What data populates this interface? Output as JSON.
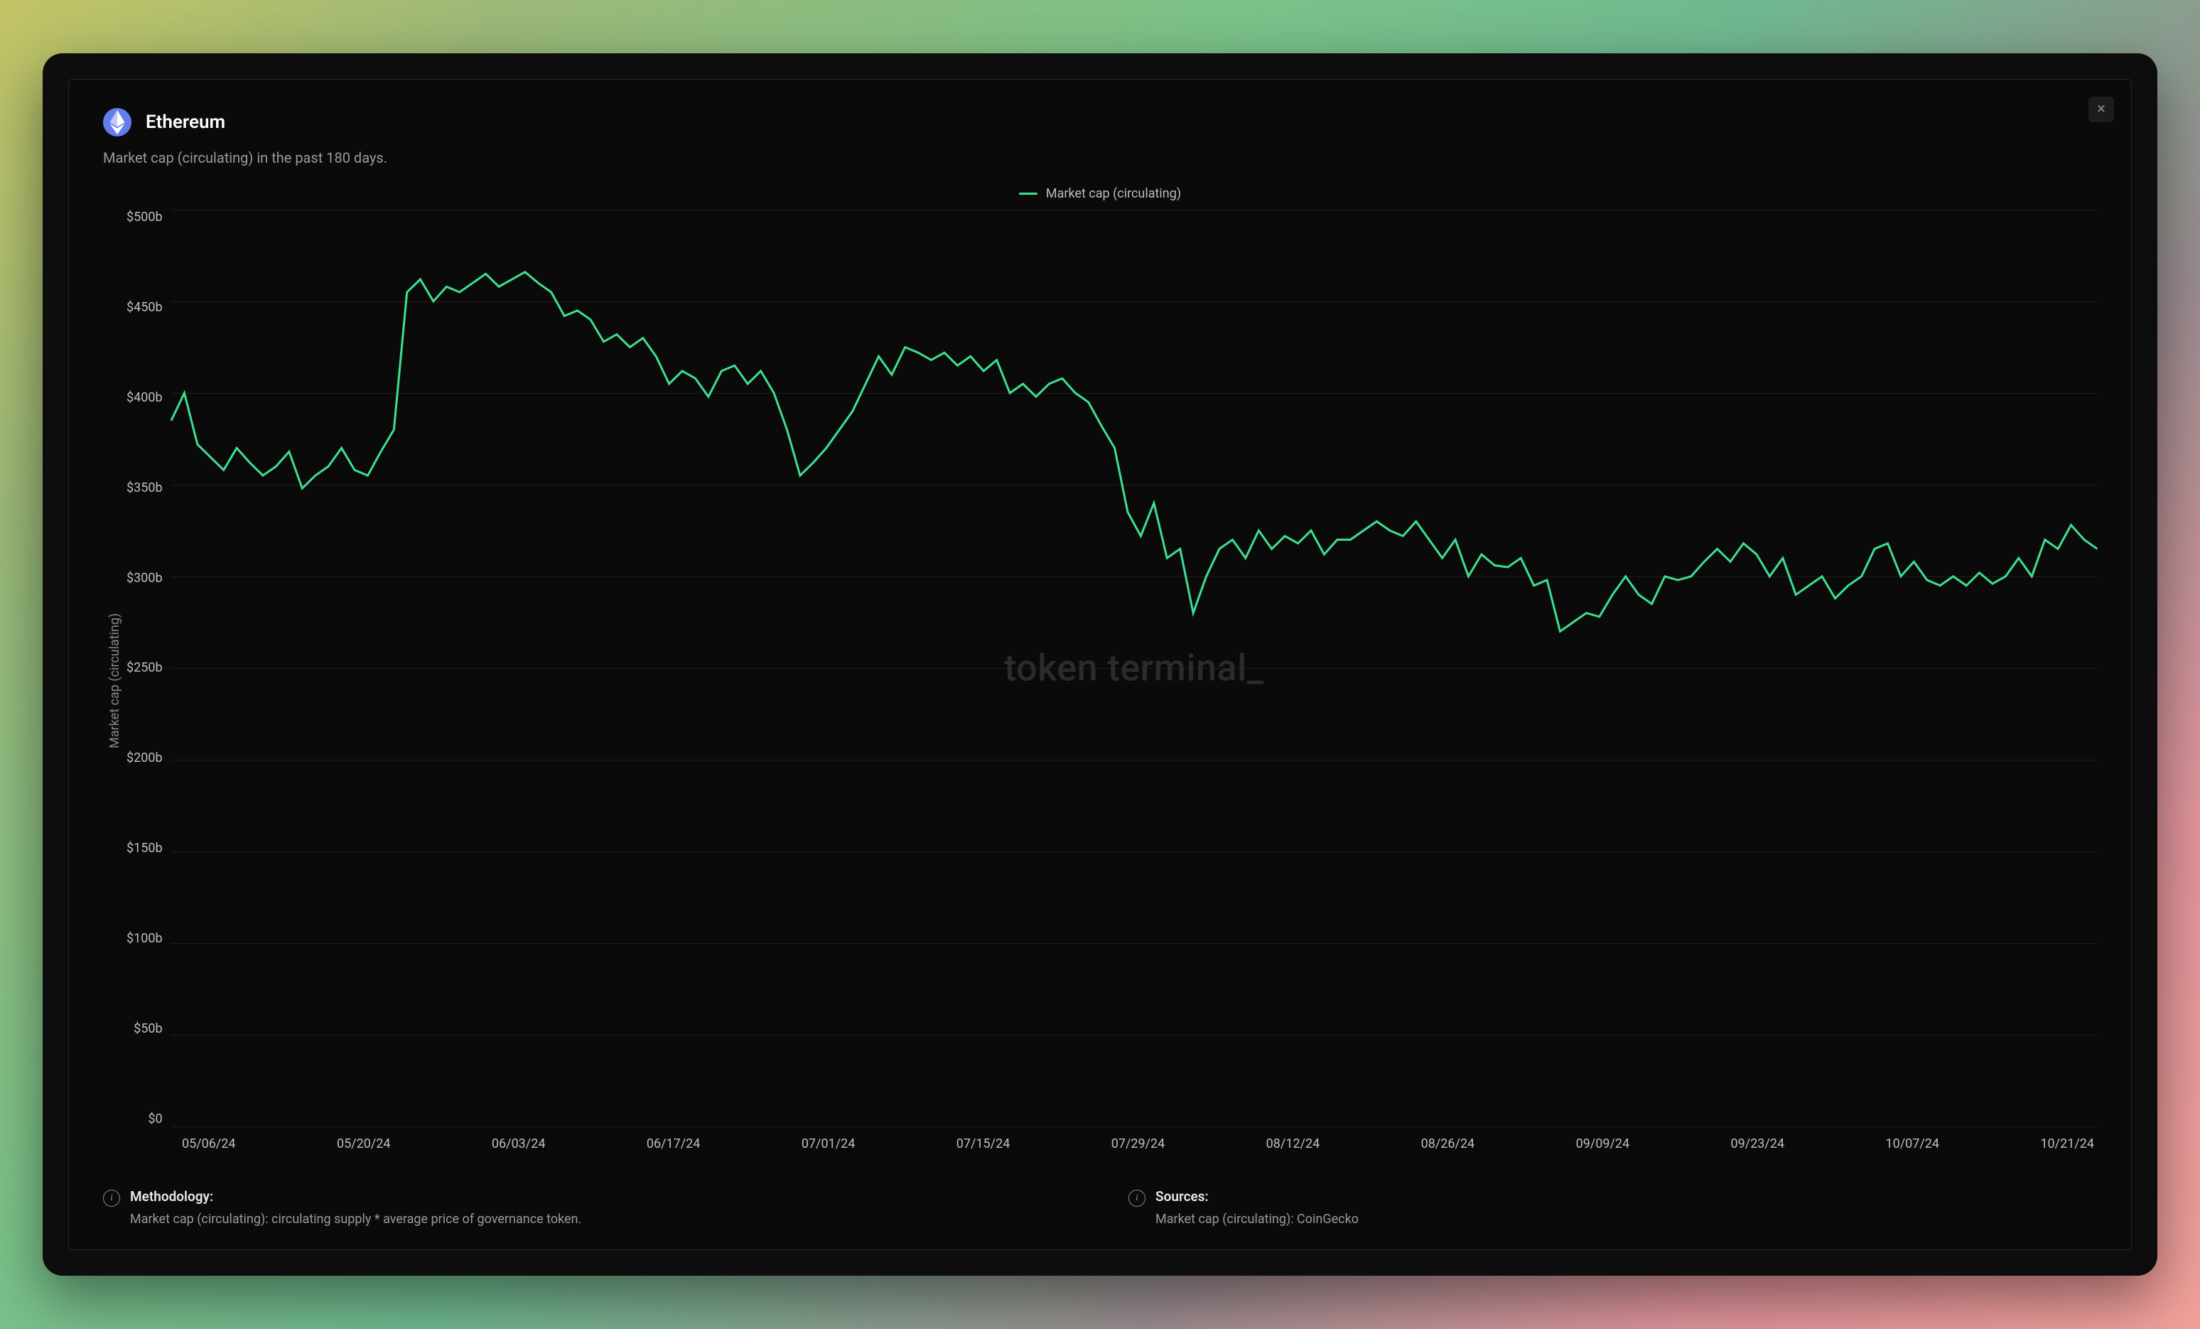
{
  "header": {
    "title": "Ethereum",
    "subtitle": "Market cap (circulating) in the past 180 days."
  },
  "legend": {
    "label": "Market cap (circulating)"
  },
  "watermark": "token terminal_",
  "footer": {
    "methodology": {
      "title": "Methodology:",
      "body": "Market cap (circulating): circulating supply * average price of governance token."
    },
    "sources": {
      "title": "Sources:",
      "body": "Market cap (circulating): CoinGecko"
    }
  },
  "chart_data": {
    "type": "line",
    "title": "Ethereum Market cap (circulating) in the past 180 days.",
    "xlabel": "",
    "ylabel": "Market cap (circulating)",
    "ylim": [
      0,
      500
    ],
    "y_unit": "b USD",
    "y_ticks": [
      "$500b",
      "$450b",
      "$400b",
      "$350b",
      "$300b",
      "$250b",
      "$200b",
      "$150b",
      "$100b",
      "$50b",
      "$0"
    ],
    "x_ticks": [
      "05/06/24",
      "05/20/24",
      "06/03/24",
      "06/17/24",
      "07/01/24",
      "07/15/24",
      "07/29/24",
      "08/12/24",
      "08/26/24",
      "09/09/24",
      "09/23/24",
      "10/07/24",
      "10/21/24"
    ],
    "series": [
      {
        "name": "Market cap (circulating)",
        "color": "#3de08f",
        "values": [
          385,
          400,
          372,
          365,
          358,
          370,
          362,
          355,
          360,
          368,
          348,
          355,
          360,
          370,
          358,
          355,
          368,
          380,
          455,
          462,
          450,
          458,
          455,
          460,
          465,
          458,
          462,
          466,
          460,
          455,
          442,
          445,
          440,
          428,
          432,
          425,
          430,
          420,
          405,
          412,
          408,
          398,
          412,
          415,
          405,
          412,
          400,
          380,
          355,
          362,
          370,
          380,
          390,
          405,
          420,
          410,
          425,
          422,
          418,
          422,
          415,
          420,
          412,
          418,
          400,
          405,
          398,
          405,
          408,
          400,
          395,
          382,
          370,
          335,
          322,
          340,
          310,
          315,
          280,
          300,
          315,
          320,
          310,
          325,
          315,
          322,
          318,
          325,
          312,
          320,
          320,
          325,
          330,
          325,
          322,
          330,
          320,
          310,
          320,
          300,
          312,
          306,
          305,
          310,
          295,
          298,
          270,
          275,
          280,
          278,
          290,
          300,
          290,
          285,
          300,
          298,
          300,
          308,
          315,
          308,
          318,
          312,
          300,
          310,
          290,
          295,
          300,
          288,
          295,
          300,
          315,
          318,
          300,
          308,
          298,
          295,
          300,
          295,
          302,
          296,
          300,
          310,
          300,
          320,
          315,
          328,
          320,
          315
        ]
      }
    ]
  }
}
